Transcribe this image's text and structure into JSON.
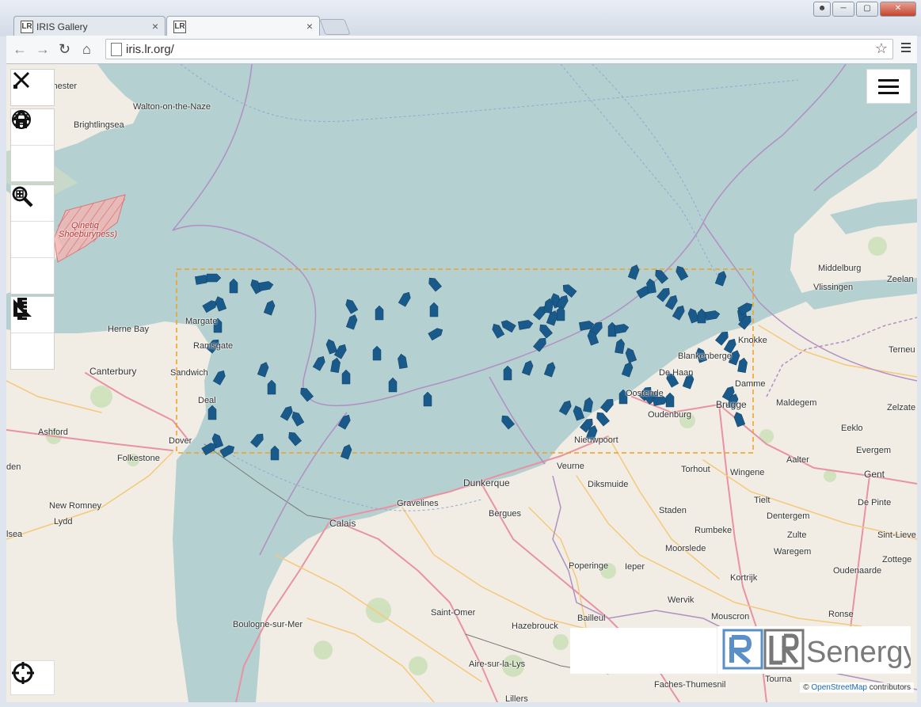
{
  "browser": {
    "tabs": [
      {
        "label": "IRIS Gallery",
        "close": "×"
      },
      {
        "label": "",
        "close": "×"
      }
    ],
    "url": "iris.lr.org/",
    "star": "☆",
    "favicon_text": "LR"
  },
  "map": {
    "places": [
      {
        "name": "chester",
        "l": 53,
        "t": 22
      },
      {
        "name": "Walton-on-the-Naze",
        "l": 160,
        "t": 48
      },
      {
        "name": "Brightlingsea",
        "l": 85,
        "t": 71
      },
      {
        "name": "Qinetiq",
        "l": 82,
        "t": 198
      },
      {
        "name": "Shoeburyness)",
        "l": 66,
        "t": 209
      },
      {
        "name": "Margate",
        "l": 226,
        "t": 319
      },
      {
        "name": "Herne Bay",
        "l": 128,
        "t": 329
      },
      {
        "name": "Ramsgate",
        "l": 236,
        "t": 350
      },
      {
        "name": "Canterbury",
        "l": 105,
        "t": 381
      },
      {
        "name": "Sandwich",
        "l": 207,
        "t": 384
      },
      {
        "name": "Deal",
        "l": 242,
        "t": 419
      },
      {
        "name": "Ashford",
        "l": 40,
        "t": 459
      },
      {
        "name": "Dover",
        "l": 205,
        "t": 470
      },
      {
        "name": "Folkestone",
        "l": 140,
        "t": 492
      },
      {
        "name": "New Romney",
        "l": 54,
        "t": 552
      },
      {
        "name": "Lydd",
        "l": 60,
        "t": 572
      },
      {
        "name": "lsea",
        "l": 0,
        "t": 588
      },
      {
        "name": "den",
        "l": 0,
        "t": 503
      },
      {
        "name": "Middelburg",
        "l": 1025,
        "t": 252
      },
      {
        "name": "Vlissingen",
        "l": 1019,
        "t": 276
      },
      {
        "name": "Zeelan",
        "l": 1112,
        "t": 266
      },
      {
        "name": "Knokke",
        "l": 924,
        "t": 343
      },
      {
        "name": "Blankenberge",
        "l": 848,
        "t": 363
      },
      {
        "name": "De Haan",
        "l": 824,
        "t": 384
      },
      {
        "name": "Damme",
        "l": 920,
        "t": 398
      },
      {
        "name": "Oostende",
        "l": 782,
        "t": 410
      },
      {
        "name": "Brugge",
        "l": 896,
        "t": 423
      },
      {
        "name": "Oudenburg",
        "l": 810,
        "t": 437
      },
      {
        "name": "Maldegem",
        "l": 972,
        "t": 422
      },
      {
        "name": "Zelzate",
        "l": 1112,
        "t": 428
      },
      {
        "name": "Terneu",
        "l": 1114,
        "t": 355
      },
      {
        "name": "Eeklo",
        "l": 1054,
        "t": 454
      },
      {
        "name": "Nieuwpoort",
        "l": 717,
        "t": 469
      },
      {
        "name": "Evergem",
        "l": 1073,
        "t": 482
      },
      {
        "name": "Aalter",
        "l": 985,
        "t": 494
      },
      {
        "name": "Veurne",
        "l": 695,
        "t": 502
      },
      {
        "name": "Torhout",
        "l": 852,
        "t": 506
      },
      {
        "name": "Wingene",
        "l": 914,
        "t": 510
      },
      {
        "name": "Gent",
        "l": 1083,
        "t": 511
      },
      {
        "name": "Dunkerque",
        "l": 577,
        "t": 522
      },
      {
        "name": "Diksmuide",
        "l": 734,
        "t": 525
      },
      {
        "name": "Gravelines",
        "l": 493,
        "t": 549
      },
      {
        "name": "Tielt",
        "l": 944,
        "t": 545
      },
      {
        "name": "De Pinte",
        "l": 1075,
        "t": 548
      },
      {
        "name": "Bergues",
        "l": 609,
        "t": 562
      },
      {
        "name": "Staden",
        "l": 824,
        "t": 558
      },
      {
        "name": "Dentergem",
        "l": 960,
        "t": 565
      },
      {
        "name": "Calais",
        "l": 408,
        "t": 573
      },
      {
        "name": "Rumbeke",
        "l": 869,
        "t": 583
      },
      {
        "name": "Zulte",
        "l": 986,
        "t": 589
      },
      {
        "name": "Sint-Lieve",
        "l": 1100,
        "t": 589
      },
      {
        "name": "Moorslede",
        "l": 832,
        "t": 606
      },
      {
        "name": "Waregem",
        "l": 969,
        "t": 610
      },
      {
        "name": "Poperinge",
        "l": 710,
        "t": 628
      },
      {
        "name": "Ieper",
        "l": 781,
        "t": 629
      },
      {
        "name": "Zottege",
        "l": 1106,
        "t": 620
      },
      {
        "name": "Oudenaarde",
        "l": 1044,
        "t": 634
      },
      {
        "name": "Kortrijk",
        "l": 914,
        "t": 643
      },
      {
        "name": "Wervik",
        "l": 835,
        "t": 671
      },
      {
        "name": "Saint-Omer",
        "l": 536,
        "t": 687
      },
      {
        "name": "Bailleul",
        "l": 721,
        "t": 694
      },
      {
        "name": "Mouscron",
        "l": 890,
        "t": 692
      },
      {
        "name": "Ronse",
        "l": 1038,
        "t": 689
      },
      {
        "name": "Boulogne-sur-Mer",
        "l": 286,
        "t": 702
      },
      {
        "name": "Hazebrouck",
        "l": 638,
        "t": 704
      },
      {
        "name": "Aire-sur-la-Lys",
        "l": 584,
        "t": 752
      },
      {
        "name": "Faches-Thumesnil",
        "l": 818,
        "t": 778
      },
      {
        "name": "Tourna",
        "l": 958,
        "t": 771
      },
      {
        "name": "Lillers",
        "l": 630,
        "t": 796
      }
    ],
    "attribution_prefix": "© ",
    "attribution_link": "OpenStreetMap",
    "attribution_suffix": " contributors"
  },
  "controls": {
    "tools": [
      "draw-tools-icon",
      "globe-icon",
      "home-icon",
      "zoom-in-icon",
      "zoom-out-icon",
      "zoom-extent-icon",
      "ruler-icon",
      "set-square-icon",
      "locate-icon",
      "menu-icon"
    ]
  },
  "logo": {
    "brand": "Senergy",
    "mark": "LR"
  },
  "colors": {
    "sea": "#b5d0d0",
    "vessel": "#1a5a8a",
    "bbox": "#f0a020"
  }
}
